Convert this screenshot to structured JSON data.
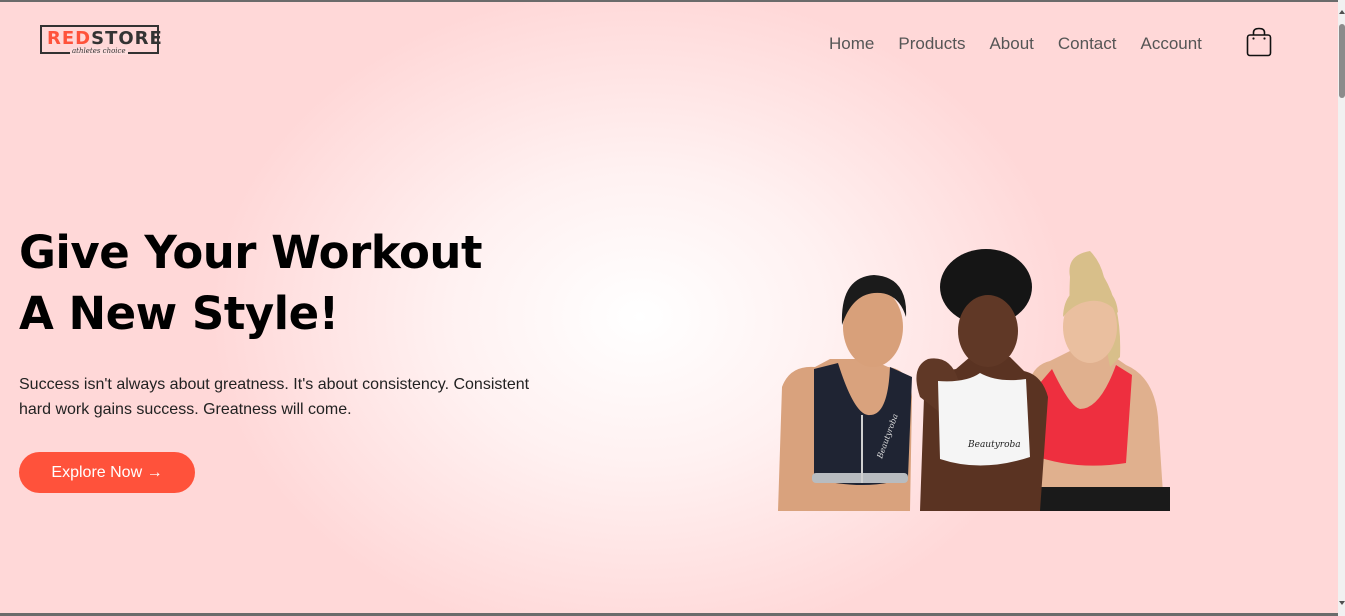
{
  "logo": {
    "red": "RED",
    "dark": "STORE",
    "tagline": "athletes choice"
  },
  "nav": {
    "items": [
      "Home",
      "Products",
      "About",
      "Contact",
      "Account"
    ]
  },
  "hero": {
    "title_line1": "Give Your Workout",
    "title_line2": "A New Style!",
    "desc_line1": "Success isn't always about greatness. It's about consistency. Consistent",
    "desc_line2": "hard work gains success. Greatness will come.",
    "button": "Explore Now →"
  },
  "image_text": {
    "bra_left": "Beautyroba",
    "bra_center": "Beautyroba"
  },
  "colors": {
    "accent": "#ff523b",
    "text": "#000000",
    "nav": "#555555",
    "bg_edge": "#ffd8d8"
  },
  "icons": {
    "cart": "shopping-bag-icon"
  }
}
